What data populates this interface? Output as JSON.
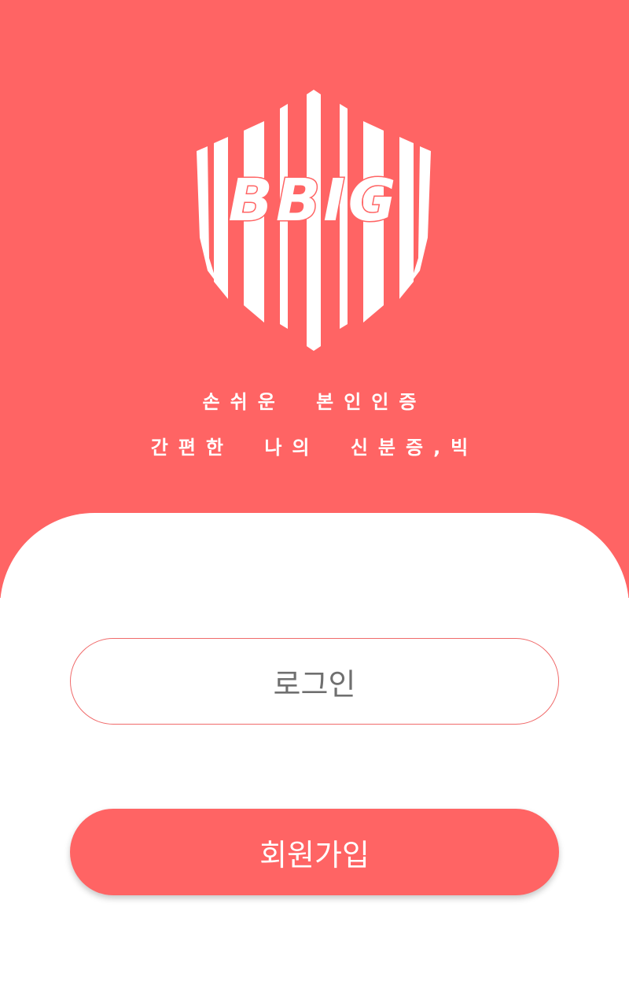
{
  "colors": {
    "brand": "#FF6464",
    "background": "#FFFFFF",
    "login_text": "#6F6F6F",
    "login_border": "#F06A6A"
  },
  "logo": {
    "text": "BBIG",
    "icon": "striped-shield-logo"
  },
  "taglines": [
    "손쉬운 본인인증",
    "간편한 나의 신분증,빅"
  ],
  "buttons": {
    "login_label": "로그인",
    "signup_label": "회원가입"
  }
}
